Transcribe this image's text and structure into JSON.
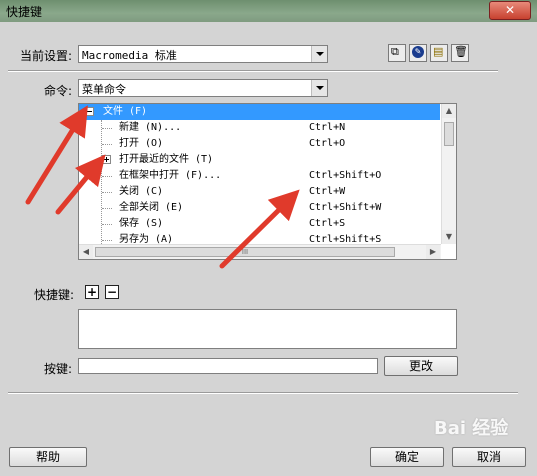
{
  "window": {
    "title": "快捷键",
    "close_glyph": "✕"
  },
  "current_set": {
    "label": "当前设置:",
    "value": "Macromedia 标准"
  },
  "toolbar": {
    "icons": [
      "duplicate-set-icon",
      "rename-set-icon",
      "export-html-icon",
      "delete-set-icon"
    ],
    "glyphs": [
      "⧉",
      "✎",
      "▤",
      "🗑"
    ]
  },
  "commands": {
    "label": "命令:",
    "value": "菜单命令"
  },
  "tree": {
    "rows": [
      {
        "name": "文件 (F)",
        "shortcut": ""
      },
      {
        "name": "新建 (N)...",
        "shortcut": "Ctrl+N"
      },
      {
        "name": "打开 (O)",
        "shortcut": "Ctrl+O"
      },
      {
        "name": "打开最近的文件 (T)",
        "shortcut": ""
      },
      {
        "name": "在框架中打开 (F)...",
        "shortcut": "Ctrl+Shift+O"
      },
      {
        "name": "关闭 (C)",
        "shortcut": "Ctrl+W"
      },
      {
        "name": "全部关闭 (E)",
        "shortcut": "Ctrl+Shift+W"
      },
      {
        "name": "保存 (S)",
        "shortcut": "Ctrl+S"
      },
      {
        "name": "另存为 (A)",
        "shortcut": "Ctrl+Shift+S"
      }
    ],
    "hscroll_grip": "III"
  },
  "shortcut": {
    "label": "快捷键:",
    "add": "+",
    "remove": "−"
  },
  "keypress": {
    "label": "按键:",
    "value": "",
    "change_label": "更改"
  },
  "footer": {
    "help": "帮助",
    "ok": "确定",
    "cancel": "取消"
  },
  "watermark": "Bai 经验",
  "colors": {
    "selection": "#3399ff",
    "annotation_arrow": "#e03a2b"
  }
}
